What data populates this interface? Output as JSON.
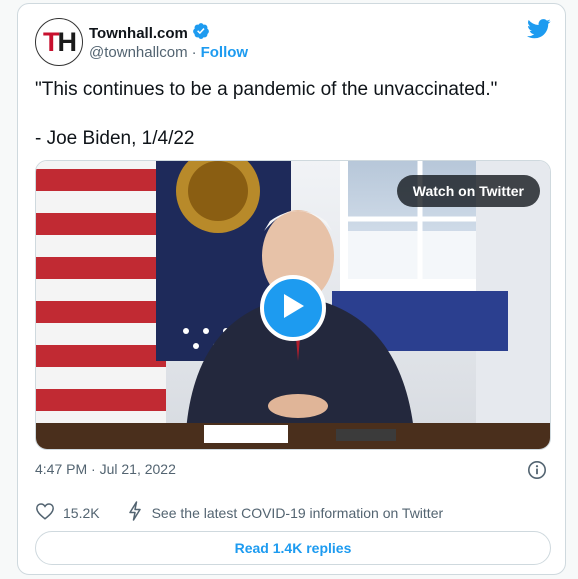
{
  "tweet": {
    "author_name": "Townhall.com",
    "author_handle": "@townhallcom",
    "follow_label": "Follow",
    "separator": "·",
    "avatar_letters": {
      "first": "T",
      "second": "H"
    },
    "text_line1": "\"This continues to be a pandemic of the unvaccinated.\"",
    "text_line2": "- Joe Biden, 1/4/22",
    "timestamp": "4:47 PM · Jul 21, 2022",
    "likes": "15.2K",
    "covid_info": "See the latest COVID-19 information on Twitter",
    "replies_label": "Read 1.4K replies"
  },
  "media": {
    "watch_label": "Watch on Twitter",
    "play_icon": "play-icon"
  },
  "icons": {
    "verified": "verified-badge-icon",
    "bird": "twitter-bird-icon",
    "info": "info-icon",
    "heart": "heart-icon",
    "bolt": "lightning-icon"
  },
  "colors": {
    "accent": "#1d9bf0",
    "secondary_text": "#536471",
    "border": "#cfd9de",
    "avatar_red": "#c8102e"
  }
}
